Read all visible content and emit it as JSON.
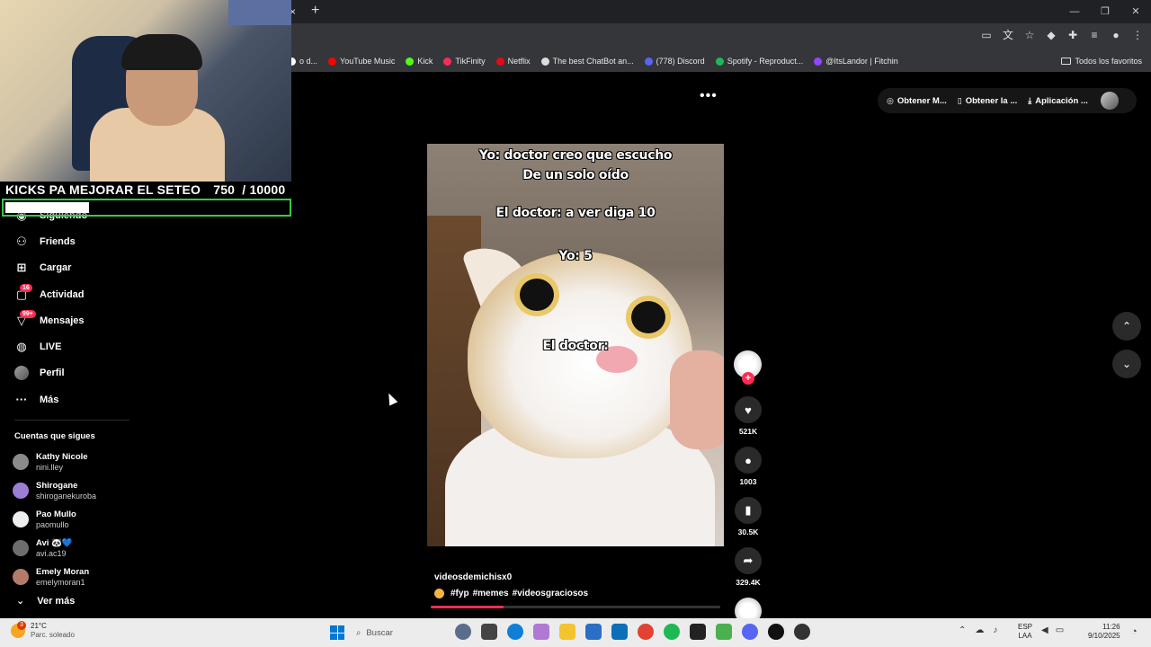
{
  "browser": {
    "tab_close": "×",
    "tab_new": "+",
    "window_controls": [
      "—",
      "❐",
      "✕"
    ],
    "bookmarks": [
      {
        "label": "o d...",
        "color": "#ffffff"
      },
      {
        "label": "YouTube Music",
        "color": "#ff0000"
      },
      {
        "label": "Kick",
        "color": "#53fc18"
      },
      {
        "label": "TikFinity",
        "color": "#fe2c55"
      },
      {
        "label": "Netflix",
        "color": "#e50914"
      },
      {
        "label": "The best ChatBot an...",
        "color": "#dddddd"
      },
      {
        "label": "(778) Discord",
        "color": "#5865f2"
      },
      {
        "label": "Spotify - Reproduct...",
        "color": "#1db954"
      },
      {
        "label": "@ItsLandor | Fitchin",
        "color": "#9146ff"
      }
    ],
    "all_bookmarks": "Todos los favoritos"
  },
  "stream": {
    "goal_label": "KICKS PA MEJORAR EL SETEO",
    "goal_current": "750",
    "goal_total": "/ 10000",
    "goal_fraction": 0.075
  },
  "sidebar": {
    "items": [
      {
        "label": "Siguiendo",
        "icon": "following-icon"
      },
      {
        "label": "Friends",
        "icon": "friends-icon"
      },
      {
        "label": "Cargar",
        "icon": "upload-icon"
      },
      {
        "label": "Actividad",
        "icon": "activity-icon",
        "badge": "16"
      },
      {
        "label": "Mensajes",
        "icon": "messages-icon",
        "badge": "99+"
      },
      {
        "label": "LIVE",
        "icon": "live-icon"
      },
      {
        "label": "Perfil",
        "icon": "profile-avatar"
      },
      {
        "label": "Más",
        "icon": "more-icon"
      }
    ],
    "following_heading": "Cuentas que sigues",
    "following": [
      {
        "name": "Kathy Nicole",
        "user": "nini.lley",
        "color": "#8a8a8a"
      },
      {
        "name": "Shirogane",
        "user": "shiroganekuroba",
        "color": "#9b7fd4"
      },
      {
        "name": "Pao Mullo",
        "user": "paomullo",
        "color": "#eeeeee"
      },
      {
        "name": "Avi 🐼💙",
        "user": "avi.ac19",
        "color": "#6d6d6d"
      },
      {
        "name": "Emely Moran",
        "user": "emelymoran1",
        "color": "#b37a6a"
      }
    ],
    "see_more": "Ver más"
  },
  "top_bar": {
    "more": "•••",
    "items": [
      "Obtener M...",
      "Obtener la ...",
      "Aplicación ..."
    ]
  },
  "video": {
    "lines": [
      "Yo: doctor creo que escucho",
      "De un solo oído",
      "El doctor: a ver diga 10",
      "Yo: 5",
      "El doctor:"
    ],
    "author": "videosdemichisx0",
    "tags": [
      "#fyp",
      "#memes",
      "#videosgraciosos"
    ],
    "progress": 0.25
  },
  "actions": {
    "likes": "521K",
    "comments": "1003",
    "saves": "30.5K",
    "shares": "329.4K"
  },
  "taskbar": {
    "temp": "21°C",
    "weather": "Parc. soleado",
    "weather_badge": "3",
    "search_placeholder": "Buscar",
    "lang1": "ESP",
    "lang2": "LAA",
    "time": "11:26",
    "date": "9/10/2025"
  }
}
